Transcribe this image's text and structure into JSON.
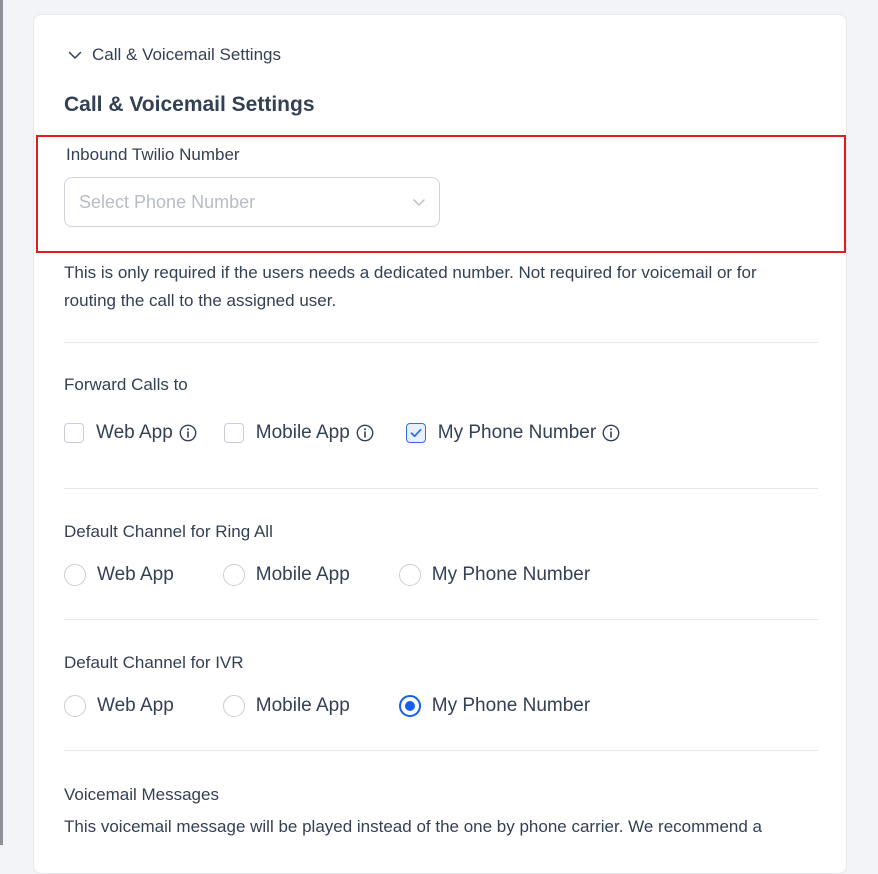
{
  "accordion": {
    "title": "Call & Voicemail Settings",
    "icon": "chevron-down-icon"
  },
  "section": {
    "title": "Call & Voicemail Settings"
  },
  "inbound": {
    "label": "Inbound Twilio Number",
    "placeholder": "Select Phone Number",
    "highlight_color": "#e11d1d",
    "help_line1": "This is only required if the users needs a dedicated number. Not required for voicemail or for",
    "help_line2": "routing the call to the assigned user."
  },
  "forward_calls": {
    "label": "Forward Calls to",
    "options": [
      {
        "label": "Web App",
        "checked": false,
        "icon": "info-icon"
      },
      {
        "label": "Mobile App",
        "checked": false,
        "icon": "info-icon"
      },
      {
        "label": "My Phone Number",
        "checked": true,
        "icon": "info-icon"
      }
    ]
  },
  "ring_all": {
    "label": "Default Channel for Ring All",
    "options": [
      {
        "label": "Web App",
        "selected": false
      },
      {
        "label": "Mobile App",
        "selected": false
      },
      {
        "label": "My Phone Number",
        "selected": false
      }
    ]
  },
  "ivr": {
    "label": "Default Channel for IVR",
    "options": [
      {
        "label": "Web App",
        "selected": false
      },
      {
        "label": "Mobile App",
        "selected": false
      },
      {
        "label": "My Phone Number",
        "selected": true
      }
    ]
  },
  "voicemail": {
    "label": "Voicemail Messages",
    "description": "This voicemail message will be played instead of the one by phone carrier. We recommend a"
  },
  "colors": {
    "accent": "#155eef",
    "text": "#344054",
    "border": "#d0d5dd"
  }
}
